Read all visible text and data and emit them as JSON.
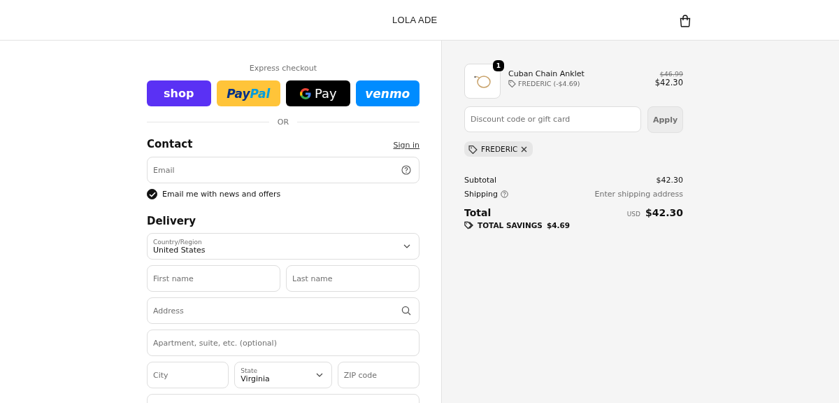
{
  "header": {
    "store_name": "LOLA ADE"
  },
  "express": {
    "title": "Express checkout",
    "buttons": [
      {
        "kind": "shop",
        "label": "shop"
      },
      {
        "kind": "paypal",
        "label": "Pay",
        "label_2": "Pal"
      },
      {
        "kind": "gpay",
        "label": "Pay"
      },
      {
        "kind": "venmo",
        "label": "venmo"
      }
    ],
    "divider": "OR"
  },
  "contact": {
    "heading": "Contact",
    "sign_in": "Sign in",
    "email": {
      "placeholder": "Email"
    },
    "newsletter": {
      "label": "Email me with news and offers",
      "checked": true
    }
  },
  "delivery": {
    "heading": "Delivery",
    "rows": [
      [
        {
          "kind": "select",
          "label": "Country/Region",
          "value": "United States"
        }
      ],
      [
        {
          "kind": "text",
          "placeholder": "First name"
        },
        {
          "kind": "text",
          "placeholder": "Last name"
        }
      ],
      [
        {
          "kind": "search",
          "placeholder": "Address"
        }
      ],
      [
        {
          "kind": "text",
          "placeholder": "Apartment, suite, etc. (optional)"
        }
      ],
      [
        {
          "kind": "text",
          "placeholder": "City"
        },
        {
          "kind": "select",
          "label": "State",
          "value": "Virginia"
        },
        {
          "kind": "text",
          "placeholder": "ZIP code"
        }
      ]
    ]
  },
  "summary": {
    "items": [
      {
        "name": "Cuban Chain Anklet",
        "quantity": "1",
        "discount": "FREDERIC (-$4.69)",
        "original_price": "$46.99",
        "price": "$42.30"
      }
    ],
    "discount_field": {
      "placeholder": "Discount code or gift card"
    },
    "apply": "Apply",
    "applied_codes": [
      "FREDERIC"
    ],
    "subtotal": {
      "label": "Subtotal",
      "value": "$42.30"
    },
    "shipping": {
      "label": "Shipping",
      "value": "Enter shipping address"
    },
    "total": {
      "label": "Total",
      "currency": "USD",
      "value": "$42.30"
    },
    "savings": {
      "label": "TOTAL SAVINGS",
      "value": "$4.69"
    }
  }
}
